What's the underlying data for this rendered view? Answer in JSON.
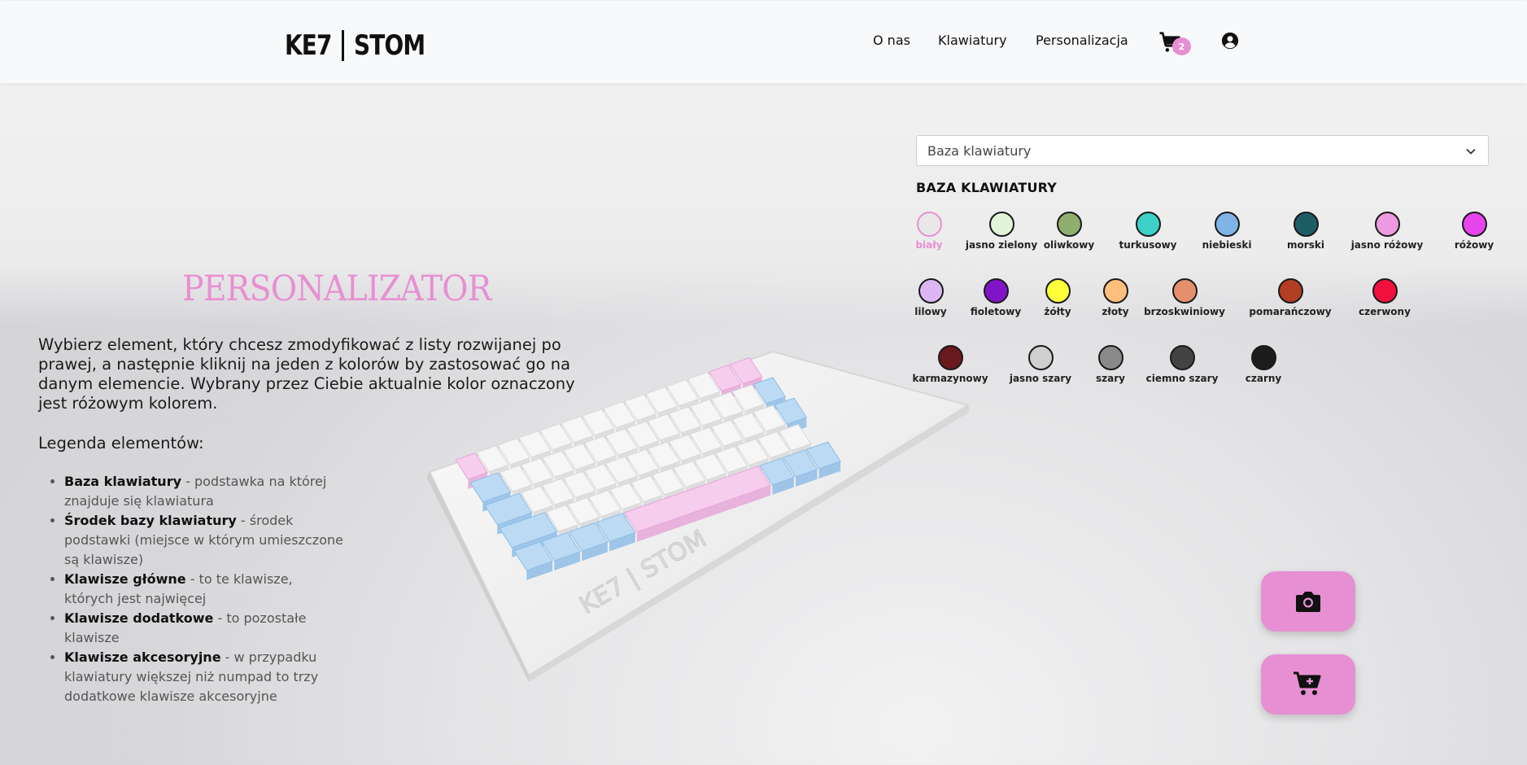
{
  "header": {
    "logo_left": "KE7",
    "logo_right": "STOM",
    "nav": [
      {
        "label": "O nas"
      },
      {
        "label": "Klawiatury"
      },
      {
        "label": "Personalizacja"
      }
    ],
    "cart_icon": "cart-icon",
    "cart_count": "2",
    "user_icon": "user-circle-icon"
  },
  "main": {
    "title": "PERSONALIZATOR",
    "intro": "Wybierz element, który chcesz zmodyfikować z listy rozwijanej po prawej, a następnie kliknij na jeden z kolorów by zastosować go na danym elemencie. Wybrany przez Ciebie aktualnie kolor oznaczony jest różowym kolorem.",
    "legend_heading": "Legenda elementów:",
    "legend": [
      {
        "term": "Baza klawiatury",
        "desc": " - podstawka na której znajduje się klawiatura"
      },
      {
        "term": "Środek bazy klawiatury",
        "desc": " - środek podstawki (miejsce w którym umieszczone są klawisze)"
      },
      {
        "term": "Klawisze główne",
        "desc": " - to te klawisze, których jest najwięcej"
      },
      {
        "term": "Klawisze dodatkowe",
        "desc": " - to pozostałe klawisze"
      },
      {
        "term": "Klawisze akcesoryjne",
        "desc": " - w przypadku klawiatury większej niż numpad to trzy dodatkowe klawisze akcesoryjne"
      }
    ],
    "keyboard_engraving": "KE7 | STOM"
  },
  "panel": {
    "select_value": "Baza klawiatury",
    "section_heading": "BAZA KLAWIATURY",
    "selected_color": "biały",
    "colors": [
      {
        "name": "biały",
        "hex": "#e8e8e8"
      },
      {
        "name": "jasno zielony",
        "hex": "#e3f5d8"
      },
      {
        "name": "oliwkowy",
        "hex": "#8fae6f"
      },
      {
        "name": "turkusowy",
        "hex": "#3cd0c6"
      },
      {
        "name": "niebieski",
        "hex": "#7fb4e6"
      },
      {
        "name": "morski",
        "hex": "#1f5d66"
      },
      {
        "name": "jasno różowy",
        "hex": "#ec9be0"
      },
      {
        "name": "różowy",
        "hex": "#e744ee"
      },
      {
        "name": "lilowy",
        "hex": "#dcb6f3"
      },
      {
        "name": "fioletowy",
        "hex": "#8214c7"
      },
      {
        "name": "żółty",
        "hex": "#ffff3a"
      },
      {
        "name": "złoty",
        "hex": "#ffbf7c"
      },
      {
        "name": "brzoskwiniowy",
        "hex": "#e5906c"
      },
      {
        "name": "pomarańczowy",
        "hex": "#b23e23"
      },
      {
        "name": "czerwony",
        "hex": "#f2103e"
      },
      {
        "name": "karmazynowy",
        "hex": "#6a1a1e"
      },
      {
        "name": "jasno szary",
        "hex": "#cfcfcf"
      },
      {
        "name": "szary",
        "hex": "#8a8a8a"
      },
      {
        "name": "ciemno szary",
        "hex": "#434343"
      },
      {
        "name": "czarny",
        "hex": "#1c1c1c"
      }
    ]
  },
  "actions": {
    "screenshot_icon": "camera-icon",
    "add_to_cart_icon": "cart-plus-icon"
  },
  "colors": {
    "accent": "#e78fd3",
    "header_bg": "#f8f9fa"
  }
}
